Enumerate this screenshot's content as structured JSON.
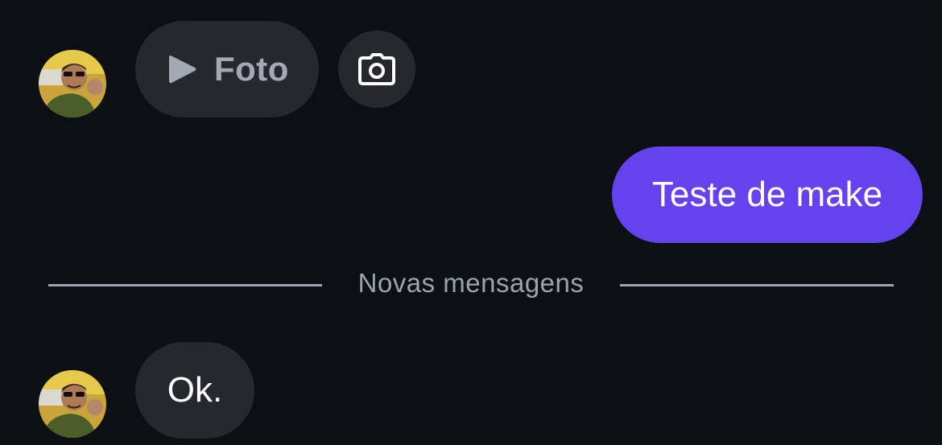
{
  "messages": [
    {
      "direction": "incoming",
      "type": "media",
      "media_label": "Foto",
      "icon": "play-icon",
      "action_icon": "camera-icon"
    },
    {
      "direction": "outgoing",
      "text": "Teste de make"
    },
    {
      "direction": "incoming",
      "text": "Ok."
    }
  ],
  "divider": {
    "label": "Novas mensagens"
  },
  "colors": {
    "background": "#0c0f14",
    "incoming_bubble": "#26282d",
    "outgoing_bubble": "#6442ee",
    "muted_text": "#9ea3ad"
  }
}
